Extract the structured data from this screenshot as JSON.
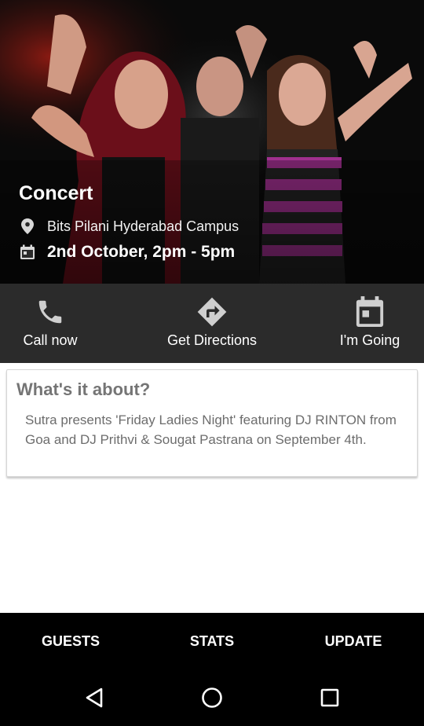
{
  "event": {
    "title": "Concert",
    "location": "Bits Pilani Hyderabad Campus",
    "datetime": "2nd October, 2pm - 5pm",
    "location_icon": "location-pin-icon",
    "date_icon": "calendar-icon"
  },
  "actions": [
    {
      "label": "Call now",
      "icon": "phone-icon"
    },
    {
      "label": "Get Directions",
      "icon": "directions-icon"
    },
    {
      "label": "I'm Going",
      "icon": "calendar-check-icon"
    }
  ],
  "about": {
    "title": "What's it about?",
    "body": "Sutra presents 'Friday Ladies Night' featuring DJ RINTON from Goa and DJ Prithvi & Sougat Pastrana on September 4th."
  },
  "tabs": [
    {
      "label": "GUESTS"
    },
    {
      "label": "STATS"
    },
    {
      "label": "UPDATE"
    }
  ],
  "navigation": {
    "back_icon": "back-triangle-icon",
    "home_icon": "home-circle-icon",
    "recents_icon": "recents-square-icon"
  },
  "colors": {
    "action_bar": "#2b2b2b",
    "tab_bar": "#000000",
    "card_title": "#757575",
    "card_text": "#6d6d6d"
  }
}
